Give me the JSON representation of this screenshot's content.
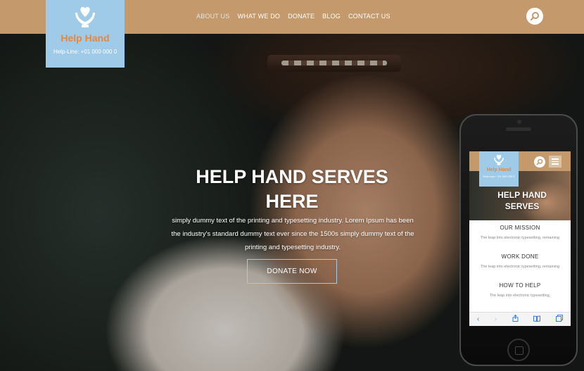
{
  "brand": {
    "name": "Help Hand",
    "helpline": "Help-Line: +01 000 000 0",
    "accent_color": "#e8873a",
    "logo_bg": "#9fcbe8",
    "bar_color": "#c49a6c"
  },
  "nav": {
    "items": [
      "ABOUT US",
      "WHAT WE DO",
      "DONATE",
      "BLOG",
      "CONTACT US"
    ],
    "active": "ABOUT US"
  },
  "search": {
    "icon": "search-icon"
  },
  "hero": {
    "title_line1": "HELP HAND SERVES",
    "title_line2": "HERE",
    "description": "simply dummy text of the printing and typesetting industry. Lorem Ipsum has been the industry's standard dummy text ever since the 1500s simply dummy text of the printing and typesetting industry.",
    "button_label": "DONATE NOW"
  },
  "mobile": {
    "brand_name": "Help Hand",
    "helpline": "Help-Line: +01 000 000 0",
    "hero_title_line1": "HELP HAND",
    "hero_title_line2": "SERVES",
    "sections": [
      {
        "heading": "OUR MISSION",
        "text": "The leap into electronic typesetting, remaining"
      },
      {
        "heading": "WORK DONE",
        "text": "The leap into electronic typesetting, remaining"
      },
      {
        "heading": "HOW TO HELP",
        "text": "The leap into electronic typesetting,"
      }
    ],
    "toolbar": [
      "back-icon",
      "forward-icon",
      "share-icon",
      "bookmarks-icon",
      "tabs-icon"
    ]
  }
}
